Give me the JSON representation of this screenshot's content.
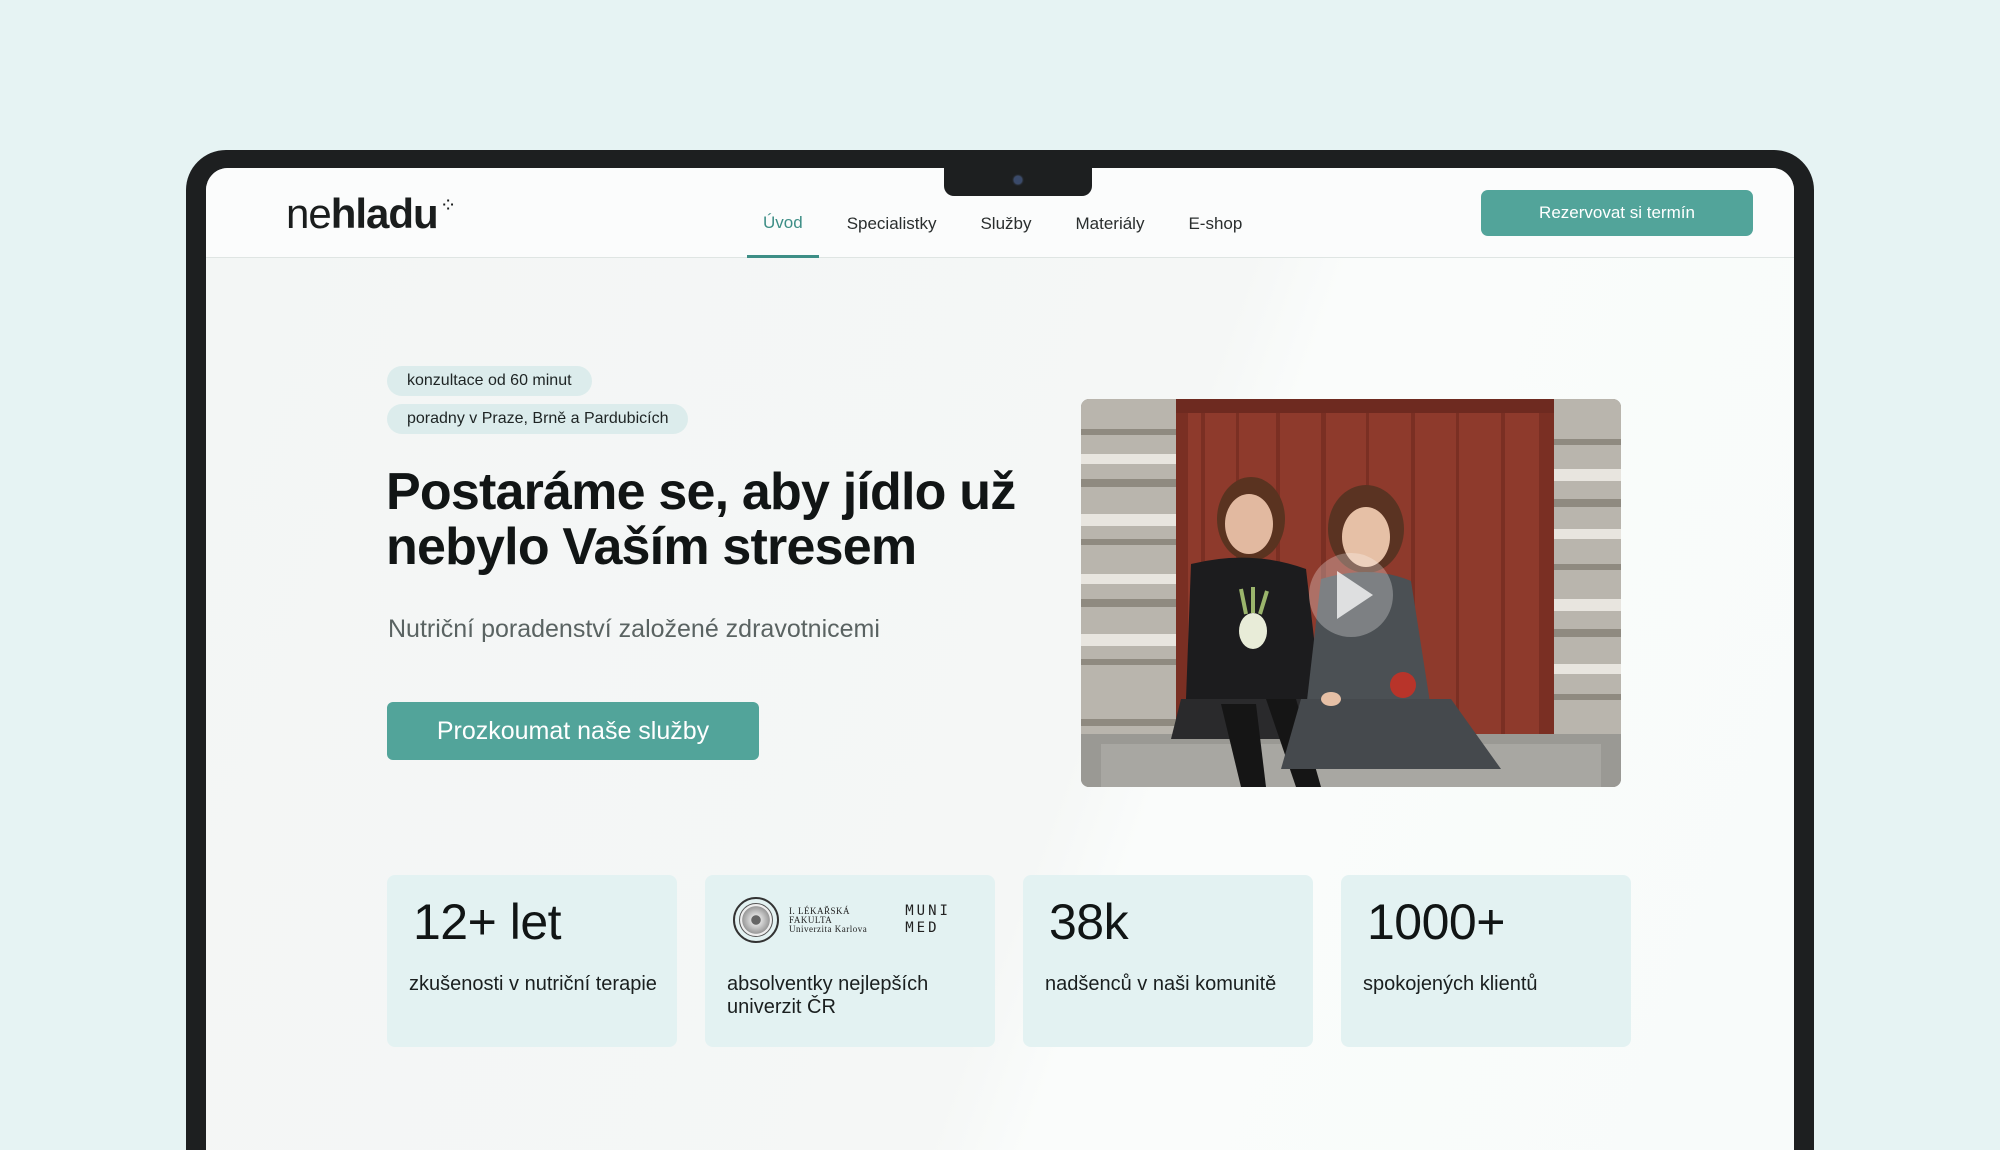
{
  "header": {
    "logo_light": "ne",
    "logo_bold": "hladu",
    "nav": [
      {
        "label": "Úvod",
        "active": true
      },
      {
        "label": "Specialistky",
        "active": false
      },
      {
        "label": "Služby",
        "active": false
      },
      {
        "label": "Materiály",
        "active": false
      },
      {
        "label": "E-shop",
        "active": false
      }
    ],
    "reserve_button": "Rezervovat si termín"
  },
  "hero": {
    "chips": [
      "konzultace od 60 minut",
      "poradny v Praze, Brně a Pardubicích"
    ],
    "title": "Postaráme se, aby jídlo už nebylo Vaším stresem",
    "subtitle": "Nutriční poradenství založené zdravotnicemi",
    "cta_button": "Prozkoumat naše služby"
  },
  "stats": [
    {
      "big": "12+ let",
      "text": "zkušenosti v nutriční terapie"
    },
    {
      "logos": {
        "lf_line1": "I. LÉKAŘSKÁ",
        "lf_line2": "FAKULTA",
        "lf_line3": "Univerzita Karlova",
        "muni_line1": "MUNI",
        "muni_line2": "MED"
      },
      "text": "absolventky nejlepších univerzit ČR"
    },
    {
      "big": "38k",
      "text": "nadšenců v naši komunitě"
    },
    {
      "big": "1000+",
      "text": "spokojených klientů"
    }
  ],
  "colors": {
    "accent": "#52a49a",
    "accent_text": "#3d8e86",
    "chip_bg": "#dcecec",
    "stat_bg": "#e3f2f2",
    "background": "#e6f3f3"
  },
  "icons": [
    "camera-icon",
    "logo-spark-icon",
    "play-icon",
    "university-seal-icon"
  ]
}
